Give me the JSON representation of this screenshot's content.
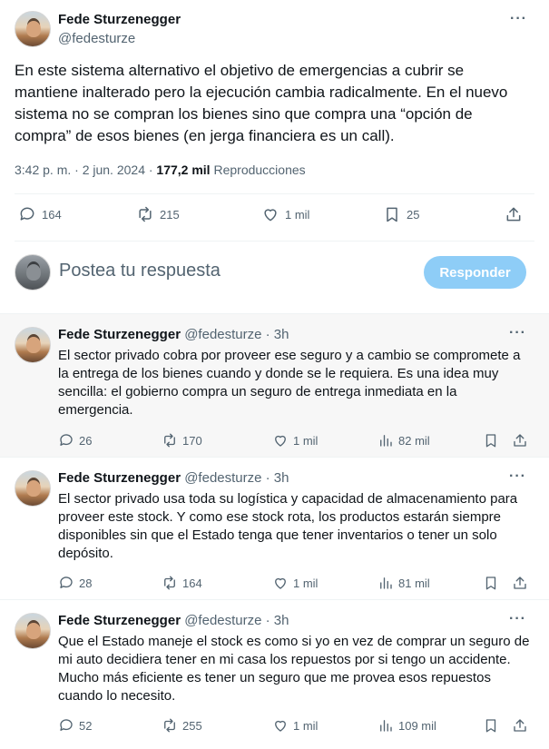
{
  "main_tweet": {
    "author_name": "Fede Sturzenegger",
    "author_handle": "@fedesturze",
    "text": "En este sistema alternativo el objetivo de emergencias a cubrir se mantiene inalterado pero la ejecución cambia radicalmente. En el nuevo sistema no se compran los bienes sino que compra una “opción de compra” de esos bienes (en jerga financiera es un call).",
    "time": "3:42 p. m. · 2 jun. 2024 · ",
    "views_count": "177,2 mil",
    "views_label": " Reproducciones",
    "replies": "164",
    "reposts": "215",
    "likes": "1 mil",
    "bookmarks": "25"
  },
  "reply_box": {
    "placeholder": "Postea tu respuesta",
    "button_label": "Responder"
  },
  "replies": [
    {
      "author_name": "Fede Sturzenegger",
      "author_handle": "@fedesturze · 3h",
      "text": "El sector privado cobra por proveer ese seguro y a cambio se compromete a la entrega de los bienes cuando y donde se le requiera. Es una idea muy sencilla: el gobierno compra un seguro de entrega inmediata en la emergencia.",
      "replies": "26",
      "reposts": "170",
      "likes": "1 mil",
      "views": "82 mil"
    },
    {
      "author_name": "Fede Sturzenegger",
      "author_handle": "@fedesturze · 3h",
      "text": "El sector privado usa toda su logística y capacidad de almacenamiento para proveer este stock. Y como ese stock rota, los productos estarán siempre disponibles sin que el Estado tenga que tener inventarios o tener un solo depósito.",
      "replies": "28",
      "reposts": "164",
      "likes": "1 mil",
      "views": "81 mil"
    },
    {
      "author_name": "Fede Sturzenegger",
      "author_handle": "@fedesturze · 3h",
      "text": "Que el Estado maneje el stock es como si yo en vez de comprar un seguro de mi auto decidiera tener en mi casa los repuestos por si tengo un accidente. Mucho más eficiente es tener un seguro que me provea esos repuestos cuando lo necesito.",
      "replies": "52",
      "reposts": "255",
      "likes": "1 mil",
      "views": "109 mil"
    }
  ],
  "icons": {
    "more": "more-horizontal-icon",
    "reply": "reply-bubble-icon",
    "repost": "repost-icon",
    "like": "heart-icon",
    "views": "views-bar-chart-icon",
    "bookmark": "bookmark-icon",
    "share": "share-icon"
  },
  "colors": {
    "text": "#0f1419",
    "secondary": "#536471",
    "button": "#8ecdf7",
    "highlight_bg": "#f7f7f7"
  }
}
